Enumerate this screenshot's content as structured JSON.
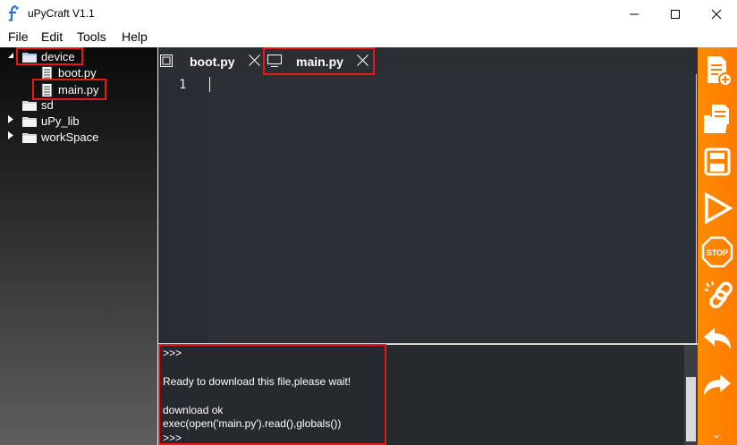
{
  "window": {
    "title": "uPyCraft V1.1",
    "minimize_glyph": "—",
    "maximize_glyph": "☐",
    "close_glyph": "✕"
  },
  "menu": [
    "File",
    "Edit",
    "Tools",
    "Help"
  ],
  "tree": {
    "device": "device",
    "files": [
      "boot.py",
      "main.py"
    ],
    "sd": "sd",
    "upy_lib": "uPy_lib",
    "workspace": "workSpace"
  },
  "tabs": [
    {
      "label": "boot.py",
      "active": false
    },
    {
      "label": "main.py",
      "active": true
    }
  ],
  "editor": {
    "line_numbers": [
      "1"
    ]
  },
  "terminal": {
    "lines": [
      ">>>",
      "",
      "Ready to download this file,please wait!",
      "",
      "download ok",
      "exec(open('main.py').read(),globals())",
      ">>>"
    ]
  },
  "toolbar": {
    "icons": [
      "new-file-icon",
      "open-folder-icon",
      "save-icon",
      "download-run-icon",
      "stop-icon",
      "connect-icon",
      "undo-icon",
      "redo-icon"
    ],
    "stop_label": "STOP",
    "more_glyph": "⌄"
  },
  "colors": {
    "accent": "#ff7f00",
    "highlight": "#e61919",
    "editor_bg": "#282c34",
    "terminal_bg": "#262a2f"
  }
}
